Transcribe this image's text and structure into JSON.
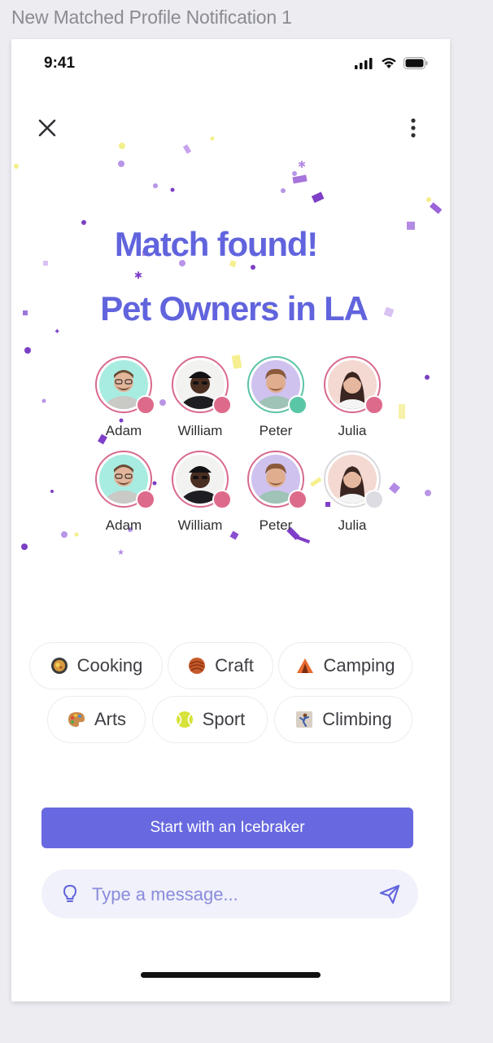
{
  "frame_title": "New Matched Profile Notification 1",
  "status_bar": {
    "time": "9:41"
  },
  "headline": {
    "line1": "Match found!",
    "line2": "Pet Owners in LA"
  },
  "profiles_row1": [
    {
      "name": "Adam",
      "status": "pink"
    },
    {
      "name": "William",
      "status": "pink"
    },
    {
      "name": "Peter",
      "status": "green"
    },
    {
      "name": "Julia",
      "status": "pink"
    }
  ],
  "profiles_row2": [
    {
      "name": "Adam",
      "status": "pink"
    },
    {
      "name": "William",
      "status": "pink"
    },
    {
      "name": "Peter",
      "status": "pink"
    },
    {
      "name": "Julia",
      "status": "grey"
    }
  ],
  "interests": [
    {
      "label": "Cooking",
      "icon": "pan-icon"
    },
    {
      "label": "Craft",
      "icon": "yarn-icon"
    },
    {
      "label": "Camping",
      "icon": "tent-icon"
    },
    {
      "label": "Arts",
      "icon": "palette-icon"
    },
    {
      "label": "Sport",
      "icon": "ball-icon"
    },
    {
      "label": "Climbing",
      "icon": "climber-icon"
    }
  ],
  "cta_label": "Start with an Icebraker",
  "composer": {
    "placeholder": "Type a message..."
  },
  "colors": {
    "accent": "#6164dd",
    "status_pink": "#de6a8b",
    "status_green": "#59c7a5",
    "status_grey": "#dcdce2"
  }
}
